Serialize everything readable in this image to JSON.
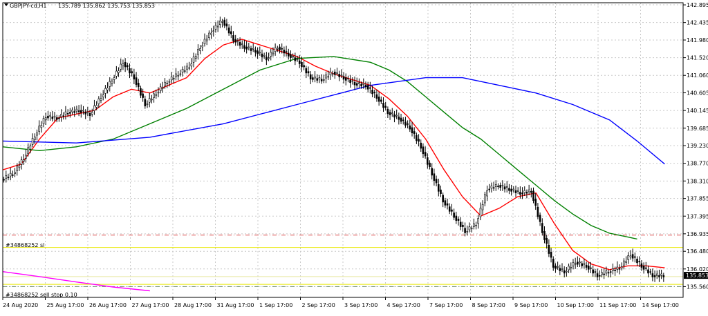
{
  "chart_data": {
    "type": "line",
    "title": "GBPJPY-cd,H1",
    "ohlc_label": "135.789 135.862 135.753 135.853",
    "current_price": 135.853,
    "y_range": [
      135.28,
      142.95
    ],
    "y_ticks": [
      "142.895",
      "142.435",
      "141.980",
      "141.520",
      "141.060",
      "140.605",
      "140.145",
      "139.685",
      "139.230",
      "138.770",
      "138.310",
      "137.855",
      "137.395",
      "136.935",
      "136.480",
      "136.020",
      "135.560"
    ],
    "x_ticks": [
      "24 Aug 2020",
      "25 Aug 17:00",
      "26 Aug 17:00",
      "27 Aug 17:00",
      "28 Aug 17:00",
      "31 Aug 17:00",
      "1 Sep 17:00",
      "2 Sep 17:00",
      "3 Sep 17:00",
      "4 Sep 17:00",
      "7 Sep 17:00",
      "8 Sep 17:00",
      "9 Sep 17:00",
      "10 Sep 17:00",
      "11 Sep 17:00",
      "14 Sep 17:00"
    ],
    "order_labels": {
      "sl": "#34868252 sl",
      "sell_stop": "#34868252 sell stop 0.10"
    },
    "levels": {
      "sl": 136.9,
      "yellow": 136.58,
      "entry": 135.82,
      "lower": 135.62,
      "bottom": 135.56
    },
    "price_path": [
      [
        0,
        138.35
      ],
      [
        6,
        138.5
      ],
      [
        12,
        138.9
      ],
      [
        18,
        139.5
      ],
      [
        24,
        140.0
      ],
      [
        30,
        139.95
      ],
      [
        36,
        140.1
      ],
      [
        42,
        140.15
      ],
      [
        48,
        140.05
      ],
      [
        54,
        140.5
      ],
      [
        60,
        140.95
      ],
      [
        66,
        141.4
      ],
      [
        72,
        141.0
      ],
      [
        78,
        140.3
      ],
      [
        84,
        140.6
      ],
      [
        90,
        140.9
      ],
      [
        96,
        141.1
      ],
      [
        102,
        141.3
      ],
      [
        108,
        141.8
      ],
      [
        114,
        142.2
      ],
      [
        120,
        142.5
      ],
      [
        126,
        142.0
      ],
      [
        132,
        141.8
      ],
      [
        138,
        141.7
      ],
      [
        144,
        141.5
      ],
      [
        150,
        141.8
      ],
      [
        156,
        141.6
      ],
      [
        162,
        141.4
      ],
      [
        168,
        141.0
      ],
      [
        174,
        140.95
      ],
      [
        180,
        141.15
      ],
      [
        186,
        141.0
      ],
      [
        192,
        140.85
      ],
      [
        198,
        140.8
      ],
      [
        204,
        140.5
      ],
      [
        210,
        140.1
      ],
      [
        216,
        139.95
      ],
      [
        222,
        139.7
      ],
      [
        228,
        139.2
      ],
      [
        234,
        138.5
      ],
      [
        240,
        137.8
      ],
      [
        246,
        137.4
      ],
      [
        252,
        137.0
      ],
      [
        258,
        137.2
      ],
      [
        264,
        138.1
      ],
      [
        270,
        138.2
      ],
      [
        276,
        138.1
      ],
      [
        282,
        138.0
      ],
      [
        288,
        138.05
      ],
      [
        294,
        137.0
      ],
      [
        300,
        136.1
      ],
      [
        306,
        135.95
      ],
      [
        312,
        136.2
      ],
      [
        318,
        136.1
      ],
      [
        324,
        135.85
      ],
      [
        330,
        135.95
      ],
      [
        336,
        136.05
      ],
      [
        342,
        136.4
      ],
      [
        348,
        136.1
      ],
      [
        354,
        135.85
      ],
      [
        360,
        135.85
      ]
    ],
    "series": [
      {
        "color": "#ff0000",
        "values": [
          [
            0,
            138.6
          ],
          [
            10,
            138.75
          ],
          [
            20,
            139.4
          ],
          [
            30,
            139.95
          ],
          [
            40,
            140.05
          ],
          [
            50,
            140.15
          ],
          [
            60,
            140.5
          ],
          [
            70,
            140.7
          ],
          [
            80,
            140.6
          ],
          [
            90,
            140.8
          ],
          [
            100,
            141.0
          ],
          [
            110,
            141.5
          ],
          [
            120,
            141.85
          ],
          [
            130,
            142.0
          ],
          [
            140,
            141.85
          ],
          [
            150,
            141.7
          ],
          [
            160,
            141.55
          ],
          [
            170,
            141.3
          ],
          [
            180,
            141.1
          ],
          [
            190,
            140.95
          ],
          [
            200,
            140.8
          ],
          [
            210,
            140.45
          ],
          [
            220,
            140.0
          ],
          [
            230,
            139.4
          ],
          [
            240,
            138.6
          ],
          [
            250,
            137.9
          ],
          [
            260,
            137.4
          ],
          [
            270,
            137.6
          ],
          [
            280,
            137.9
          ],
          [
            290,
            138.0
          ],
          [
            300,
            137.2
          ],
          [
            310,
            136.5
          ],
          [
            320,
            136.15
          ],
          [
            330,
            136.0
          ],
          [
            340,
            136.1
          ],
          [
            350,
            136.1
          ],
          [
            360,
            136.05
          ]
        ]
      },
      {
        "color": "#008000",
        "values": [
          [
            0,
            139.2
          ],
          [
            20,
            139.1
          ],
          [
            40,
            139.2
          ],
          [
            60,
            139.4
          ],
          [
            80,
            139.8
          ],
          [
            100,
            140.2
          ],
          [
            120,
            140.7
          ],
          [
            140,
            141.2
          ],
          [
            160,
            141.5
          ],
          [
            180,
            141.55
          ],
          [
            200,
            141.4
          ],
          [
            210,
            141.2
          ],
          [
            220,
            140.9
          ],
          [
            230,
            140.5
          ],
          [
            240,
            140.1
          ],
          [
            250,
            139.7
          ],
          [
            260,
            139.4
          ],
          [
            270,
            139.0
          ],
          [
            280,
            138.6
          ],
          [
            290,
            138.2
          ],
          [
            300,
            137.8
          ],
          [
            310,
            137.45
          ],
          [
            320,
            137.15
          ],
          [
            330,
            136.95
          ],
          [
            340,
            136.85
          ],
          [
            345,
            136.8
          ]
        ]
      },
      {
        "color": "#0000ff",
        "values": [
          [
            0,
            139.35
          ],
          [
            40,
            139.3
          ],
          [
            80,
            139.45
          ],
          [
            120,
            139.8
          ],
          [
            160,
            140.3
          ],
          [
            200,
            140.8
          ],
          [
            230,
            141.0
          ],
          [
            250,
            141.0
          ],
          [
            270,
            140.8
          ],
          [
            290,
            140.6
          ],
          [
            310,
            140.3
          ],
          [
            330,
            139.9
          ],
          [
            345,
            139.35
          ],
          [
            360,
            138.75
          ]
        ]
      },
      {
        "color": "#ff00ff",
        "values": [
          [
            0,
            135.95
          ],
          [
            20,
            135.82
          ],
          [
            40,
            135.68
          ],
          [
            60,
            135.55
          ],
          [
            80,
            135.45
          ]
        ]
      }
    ],
    "colors": {
      "grid": "#c8c8c8",
      "candle": "#000000",
      "price_tag_bg": "#000000",
      "price_tag_fg": "#ffffff"
    },
    "grid": true
  }
}
